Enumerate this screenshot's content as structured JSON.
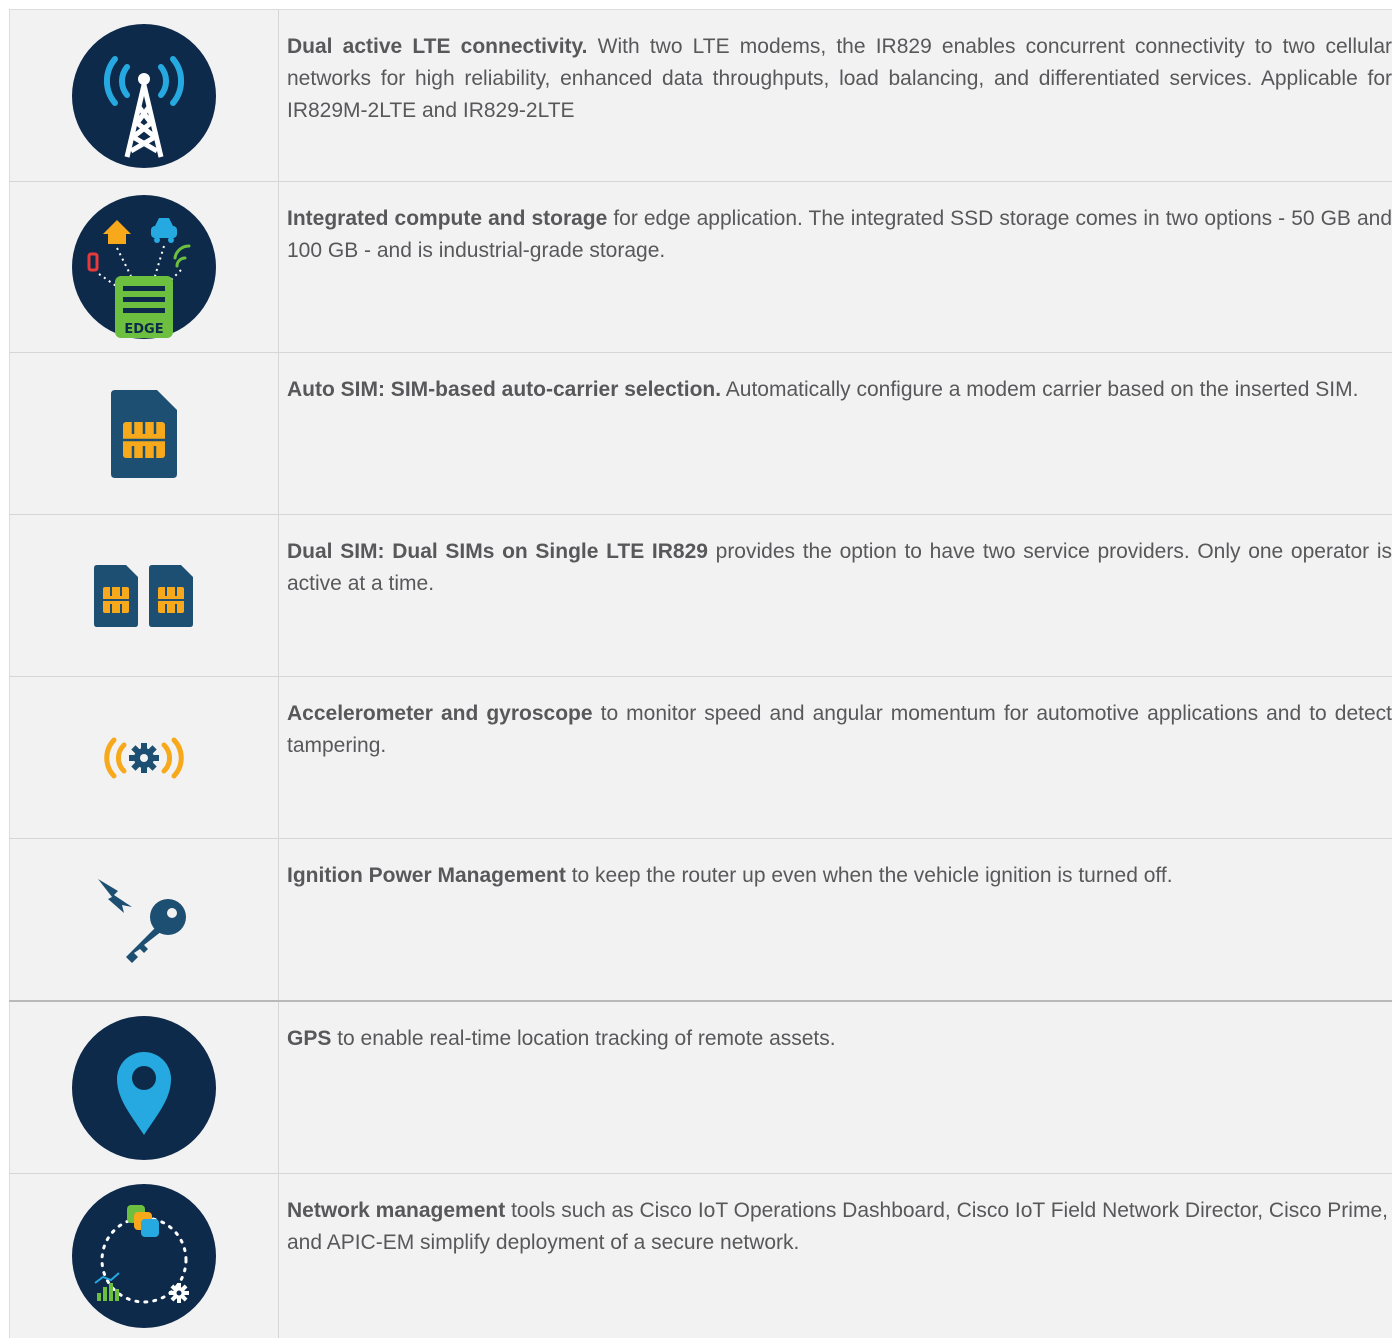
{
  "rows": [
    {
      "bold": "Dual active LTE connectivity.",
      "text": " With two LTE modems, the IR829 enables concurrent connectivity to two cellular networks for high reliability, enhanced data throughputs, load balancing, and differentiated services. Applicable for IR829M-2LTE and IR829-2LTE",
      "icon": "cell-tower-icon"
    },
    {
      "bold": "Integrated compute and storage",
      "text": " for edge application. The integrated SSD storage comes in two options - 50 GB and 100 GB - and is industrial-grade storage.",
      "icon": "edge-compute-icon",
      "icon_label": "EDGE"
    },
    {
      "bold": "Auto SIM: SIM-based auto-carrier selection.",
      "text": " Automatically configure a modem carrier based on the inserted SIM.",
      "icon": "sim-card-icon"
    },
    {
      "bold": "Dual SIM: Dual SIMs on Single LTE IR829",
      "text": " provides the option to have two service providers. Only one operator is active at a time.",
      "icon": "dual-sim-icon"
    },
    {
      "bold": "Accelerometer and gyroscope",
      "text": " to monitor speed and angular momentum for automotive applications and to detect tampering.",
      "icon": "vibration-gear-icon"
    },
    {
      "bold": "Ignition Power Management",
      "text": " to keep the router up even when the vehicle ignition is turned off.",
      "icon": "ignition-key-icon"
    },
    {
      "bold": "GPS",
      "text": " to enable real-time location tracking of remote assets.",
      "icon": "map-pin-icon"
    },
    {
      "bold": "Network management",
      "text": " tools such as Cisco IoT Operations Dashboard, Cisco IoT Field Network Director,  Cisco Prime, and APIC-EM simplify deployment of a secure network.",
      "icon": "network-management-icon"
    }
  ],
  "colors": {
    "navy": "#0d2a4a",
    "cyan": "#26a9e0",
    "orange": "#f7a81b",
    "green": "#6cbf3f",
    "sim_blue": "#1d4f72",
    "row_bg": "#f2f2f2",
    "text": "#58585b"
  }
}
